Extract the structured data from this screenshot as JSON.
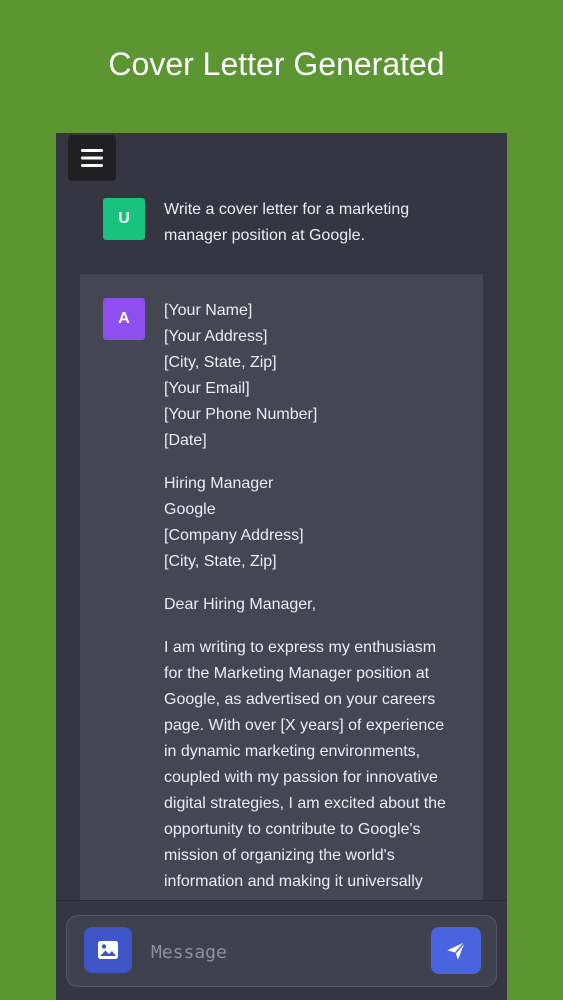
{
  "banner": {
    "title": "Cover Letter Generated"
  },
  "menu": {
    "icon": "hamburger-menu-icon"
  },
  "conversation": {
    "user": {
      "avatar": "U",
      "avatar_color": "#19c37d",
      "lines": [
        "Write a cover letter for a marketing",
        "manager position at Google."
      ]
    },
    "assistant": {
      "avatar": "A",
      "avatar_color": "#8e4ef0",
      "paragraphs": [
        [
          "[Your Name]",
          "[Your Address]",
          "[City, State, Zip]",
          "[Your Email]",
          "[Your Phone Number]",
          "[Date]"
        ],
        [
          "Hiring Manager",
          "Google",
          "[Company Address]",
          "[City, State, Zip]"
        ],
        [
          "Dear Hiring Manager,"
        ],
        [
          "I am writing to express my enthusiasm",
          "for the Marketing Manager position at",
          "Google, as advertised on your careers",
          "page. With over [X years] of experience",
          "in dynamic marketing environments,",
          "coupled with my passion for innovative",
          "digital strategies, I am excited about the",
          "opportunity to contribute to Google's",
          "mission of organizing the world's",
          "information and making it universally"
        ]
      ]
    }
  },
  "composer": {
    "placeholder": "Message",
    "image_button_icon": "image-icon",
    "send_button_icon": "send-icon",
    "accent_color": "#4a63df"
  },
  "colors": {
    "background": "#5b9632",
    "app_background": "#363643",
    "assistant_bubble": "#444654"
  }
}
